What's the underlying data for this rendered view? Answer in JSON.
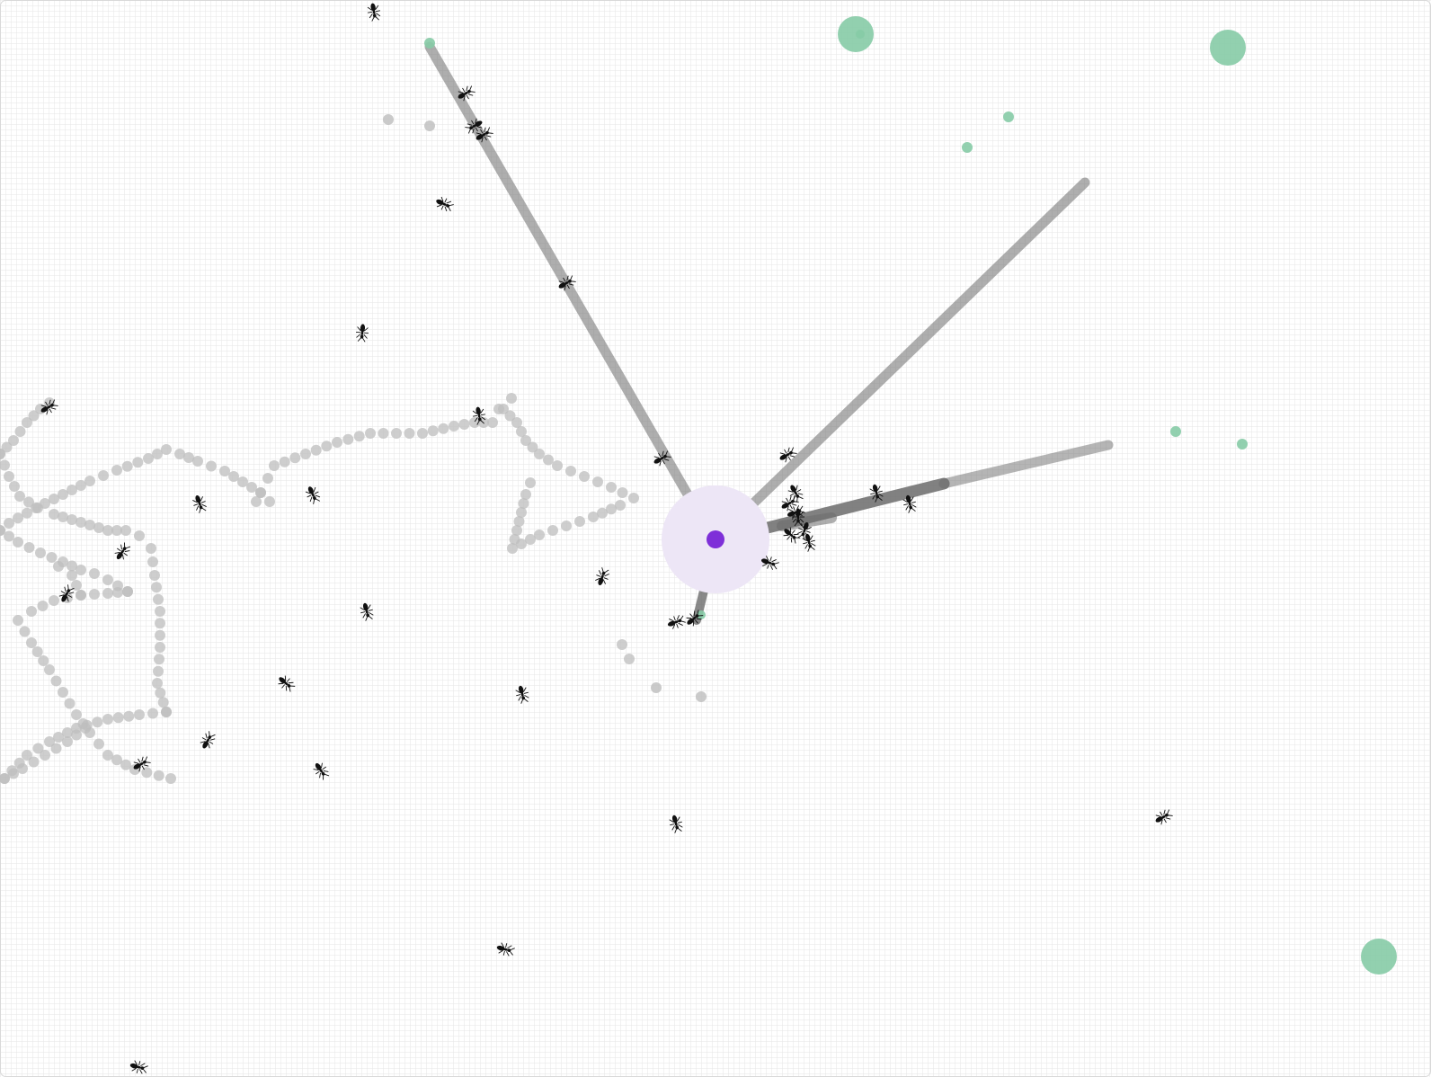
{
  "simulation": {
    "colors": {
      "background": "#ffffff",
      "grid": "#e6e6e6",
      "nest_zone": "#ede6f6",
      "nest_core": "#7e2fd8",
      "food": "#86cba6",
      "pheromone_home": "#bdbdbd",
      "pheromone_food": "#6b6b6b",
      "ant": "#111111"
    },
    "icons": {
      "nest": "nest-icon",
      "food": "food-icon",
      "ant": "ant-icon"
    }
  }
}
